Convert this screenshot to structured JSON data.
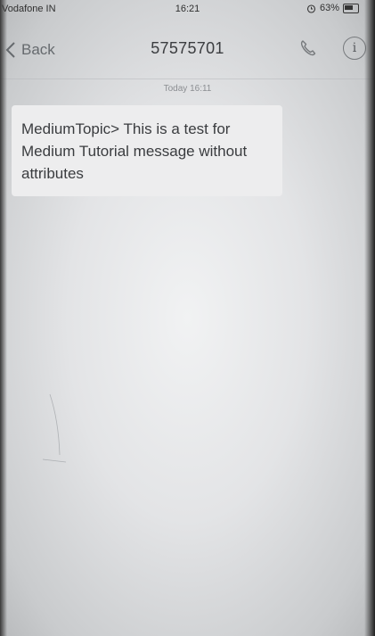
{
  "status_bar": {
    "carrier": "Vodafone IN",
    "time": "16:21",
    "battery": "63%"
  },
  "header": {
    "back_label": "Back",
    "title": "57575701"
  },
  "conversation": {
    "timestamp": "Today 16:11",
    "messages": [
      {
        "text": "MediumTopic> This is a test for Medium Tutorial message without attributes"
      }
    ]
  },
  "icons": {
    "back": "chevron-left-icon",
    "phone": "phone-icon",
    "info": "info-icon",
    "alarm": "alarm-icon",
    "battery": "battery-icon"
  },
  "colors": {
    "bubble": "#ededee",
    "text": "#3a3c3f",
    "nav_icon": "#777a7d"
  }
}
